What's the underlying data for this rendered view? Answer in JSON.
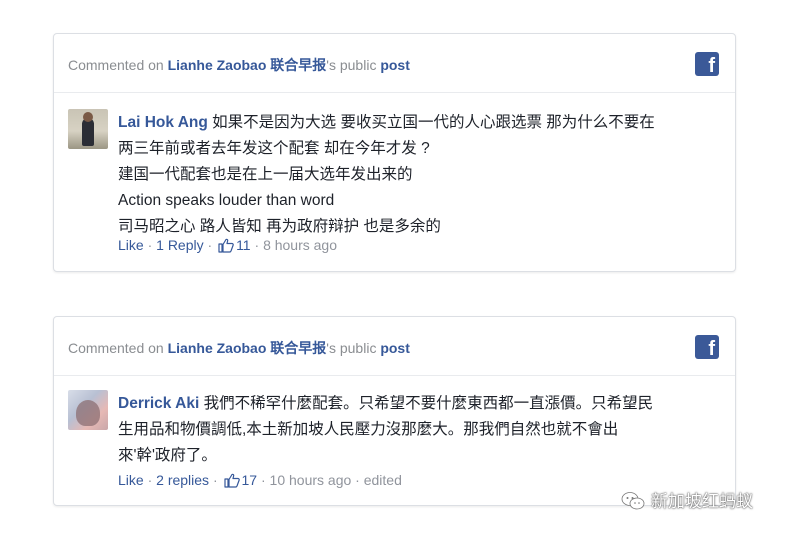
{
  "cards": [
    {
      "header": {
        "prefix": "Commented on ",
        "page_name": "Lianhe Zaobao 联合早报",
        "suffix": "'s public ",
        "post_link": "post"
      },
      "fb_icon": "facebook-icon",
      "comment": {
        "author": "Lai Hok Ang",
        "lines": [
          "如果不是因为大选 要收买立国一代的人心跟选票 那为什么不要在",
          "两三年前或者去年发这个配套 却在今年才发 ?",
          "建国一代配套也是在上一届大选年发出来的",
          "Action speaks louder than word",
          "司马昭之心 路人皆知 再为政府辩护 也是多余的"
        ]
      },
      "meta": {
        "like": "Like",
        "sep1": " · ",
        "replies": "1 Reply",
        "sep2": " · ",
        "likes_count": "11",
        "sep3": " · ",
        "time": "8 hours ago",
        "edited": ""
      }
    },
    {
      "header": {
        "prefix": "Commented on ",
        "page_name": "Lianhe Zaobao 联合早报",
        "suffix": "'s public ",
        "post_link": "post"
      },
      "fb_icon": "facebook-icon",
      "comment": {
        "author": "Derrick Aki",
        "lines": [
          "我們不稀罕什麼配套。只希望不要什麼東西都一直漲價。只希望民",
          "生用品和物價調低,本土新加坡人民壓力沒那麼大。那我們自然也就不會出",
          "來'幹'政府了。"
        ]
      },
      "meta": {
        "like": "Like",
        "sep1": " · ",
        "replies": "2 replies",
        "sep2": " · ",
        "likes_count": "17",
        "sep3": " · ",
        "time": "10 hours ago",
        "edited": " · edited"
      }
    }
  ],
  "watermark": {
    "text": "新加坡红蚂蚁",
    "icon": "wechat-icon"
  },
  "colors": {
    "link_blue": "#365899",
    "facebook_blue": "#3b5998",
    "meta_gray": "#90949c",
    "text_dark": "#1d2129"
  }
}
